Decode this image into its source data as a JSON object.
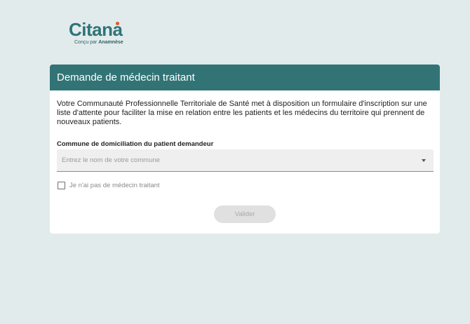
{
  "brand": {
    "name": "Citana",
    "tagline_prefix": "Conçu par",
    "tagline_brand": "Anamnèse",
    "accent_color": "#e0582a",
    "primary_color": "#327475"
  },
  "card": {
    "title": "Demande de médecin traitant",
    "intro": "Votre Communauté Professionnelle Territoriale de Santé met à disposition un formulaire d'inscription sur une liste d'attente pour faciliter la mise en relation entre les patients et les médecins du territoire qui prennent de nouveaux patients."
  },
  "form": {
    "commune_label": "Commune de domiciliation du patient demandeur",
    "commune_placeholder": "Entrez le nom de votre commune",
    "commune_value": "",
    "no_doctor_label": "Je n'ai pas de médecin traitant",
    "no_doctor_checked": false,
    "submit_label": "Valider",
    "submit_disabled": true
  },
  "icons": {
    "dropdown": "chevron-down-icon",
    "checkbox": "checkbox-unchecked-icon"
  }
}
